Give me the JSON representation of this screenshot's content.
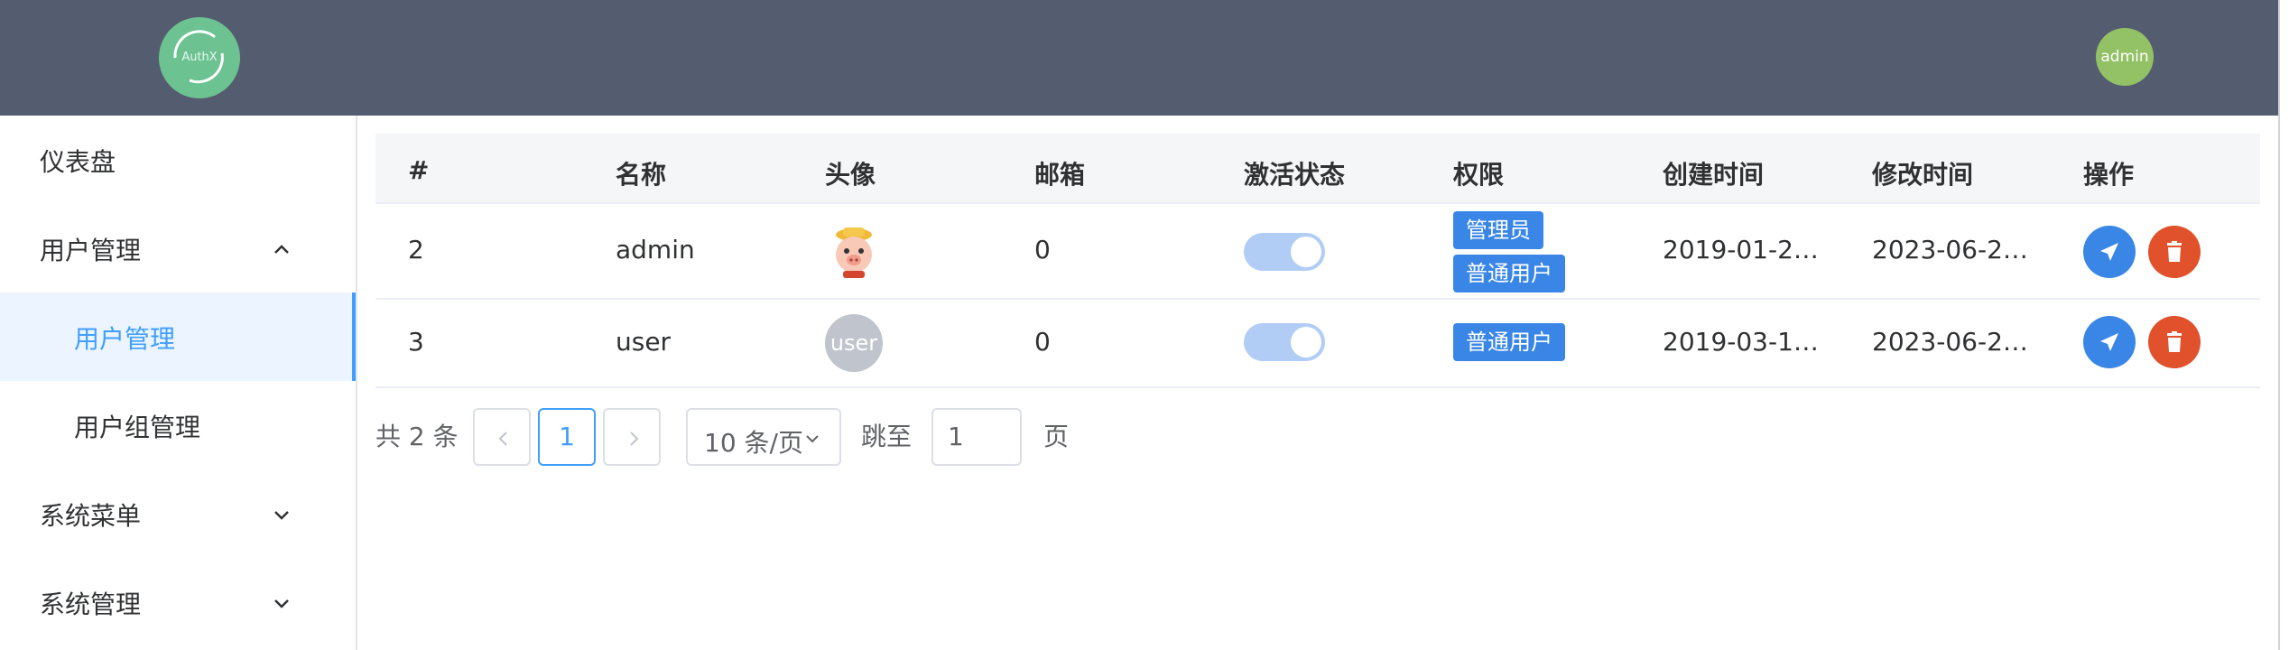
{
  "header": {
    "logo_text": "AuthX",
    "user_avatar_text": "admin"
  },
  "sidebar": {
    "items": [
      {
        "label": "仪表盘"
      },
      {
        "label": "用户管理"
      },
      {
        "label": "用户管理"
      },
      {
        "label": "用户组管理"
      },
      {
        "label": "系统菜单"
      },
      {
        "label": "系统管理"
      }
    ]
  },
  "table": {
    "columns": [
      "#",
      "名称",
      "头像",
      "邮箱",
      "激活状态",
      "权限",
      "创建时间",
      "修改时间",
      "操作"
    ],
    "rows": [
      {
        "id": "2",
        "name": "admin",
        "avatar": "pig-avatar",
        "email": "0",
        "active": true,
        "roles": [
          "管理员",
          "普通用户"
        ],
        "created": "2019-01-2…",
        "modified": "2023-06-2…"
      },
      {
        "id": "3",
        "name": "user",
        "avatar": "user",
        "email": "0",
        "active": true,
        "roles": [
          "普通用户"
        ],
        "created": "2019-03-1…",
        "modified": "2023-06-2…"
      }
    ]
  },
  "pagination": {
    "total": "共 2 条",
    "current_page": "1",
    "page_size": "10 条/页",
    "jump_label": "跳至",
    "jump_value": "1",
    "page_suffix": "页"
  },
  "colors": {
    "header_bg": "#545c70",
    "accent": "#409eff",
    "tag_blue": "#3a86e6",
    "delete_red": "#e0512c",
    "logo_green": "#6cc391"
  }
}
